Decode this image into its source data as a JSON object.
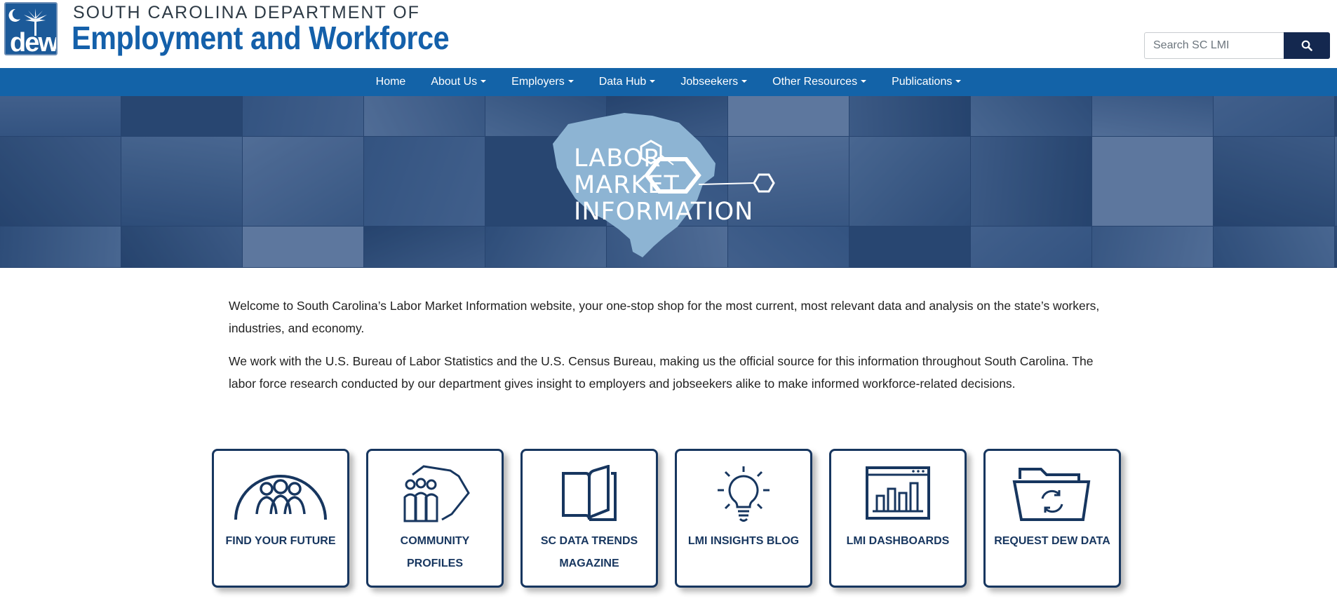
{
  "header": {
    "logo_text": "dew",
    "org_line1": "SOUTH CAROLINA DEPARTMENT OF",
    "org_line2": "Employment and Workforce",
    "search_placeholder": "Search SC LMI",
    "search_icon": "search-icon"
  },
  "nav": {
    "items": [
      {
        "label": "Home",
        "dropdown": false
      },
      {
        "label": "About Us",
        "dropdown": true
      },
      {
        "label": "Employers",
        "dropdown": true
      },
      {
        "label": "Data Hub",
        "dropdown": true
      },
      {
        "label": "Jobseekers",
        "dropdown": true
      },
      {
        "label": "Other Resources",
        "dropdown": true
      },
      {
        "label": "Publications",
        "dropdown": true
      }
    ]
  },
  "hero": {
    "title_lines": [
      "LABOR",
      "MARKET",
      "INFORMATION"
    ]
  },
  "intro": {
    "paragraph1": "Welcome to South Carolina’s Labor Market Information website, your one-stop shop for the most current, most relevant data and analysis on the state’s workers, industries, and economy.",
    "paragraph2": "We work with the U.S. Bureau of Labor Statistics and the U.S. Census Bureau, making us the official source for this information throughout South Carolina. The labor force research conducted by our department gives insight to employers and jobseekers alike to make informed workforce-related decisions."
  },
  "cards": [
    {
      "label": "FIND YOUR FUTURE",
      "icon": "people-dome-icon"
    },
    {
      "label": "COMMUNITY PROFILES",
      "icon": "community-map-icon"
    },
    {
      "label": "SC DATA TRENDS MAGAZINE",
      "icon": "open-book-icon"
    },
    {
      "label": "LMI INSIGHTS BLOG",
      "icon": "lightbulb-icon"
    },
    {
      "label": "LMI DASHBOARDS",
      "icon": "dashboard-chart-icon"
    },
    {
      "label": "REQUEST DEW DATA",
      "icon": "folder-refresh-icon"
    }
  ],
  "colors": {
    "brand_blue": "#1460aa",
    "nav_blue": "#1363a8",
    "navy": "#17365f",
    "search_button": "#14284f"
  }
}
